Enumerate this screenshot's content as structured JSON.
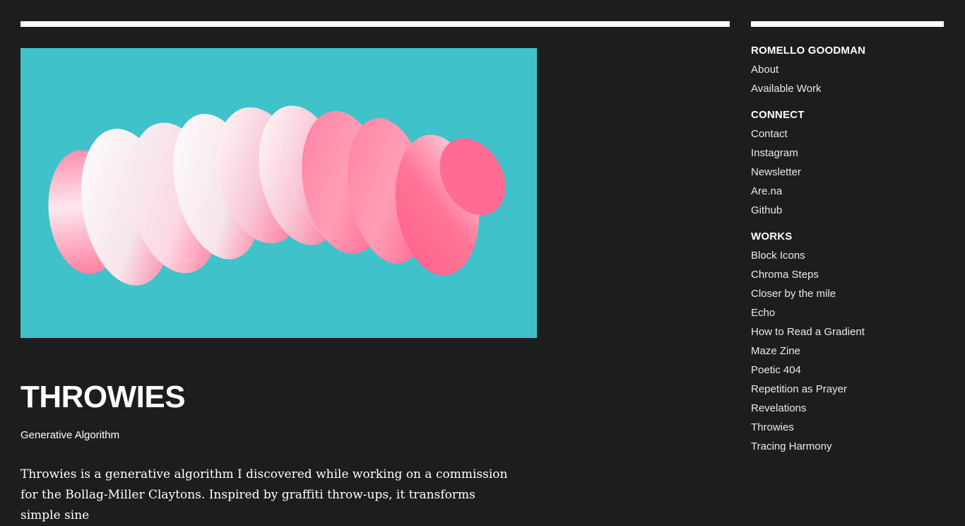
{
  "colors": {
    "background": "#1d1d1d",
    "artwork_background": "#3fc2ca",
    "accent_pink": "#ff5f8a",
    "text": "#ffffff"
  },
  "work": {
    "title": "THROWIES",
    "subtitle": "Generative Algorithm",
    "body": "Throwies is a generative algorithm I discovered while working on a commission for the Bollag-Miller Claytons. Inspired by graffiti throw-ups, it transforms simple sine"
  },
  "sidebar": {
    "groups": [
      {
        "heading": "ROMELLO GOODMAN",
        "links": [
          "About",
          "Available Work"
        ]
      },
      {
        "heading": "CONNECT",
        "links": [
          "Contact",
          "Instagram",
          "Newsletter",
          "Are.na",
          "Github"
        ]
      },
      {
        "heading": "WORKS",
        "links": [
          "Block Icons",
          "Chroma Steps",
          "Closer by the mile",
          "Echo",
          "How to Read a Gradient",
          "Maze Zine",
          "Poetic 404",
          "Repetition as Prayer",
          "Revelations",
          "Throwies",
          "Tracing Harmony"
        ]
      }
    ]
  }
}
